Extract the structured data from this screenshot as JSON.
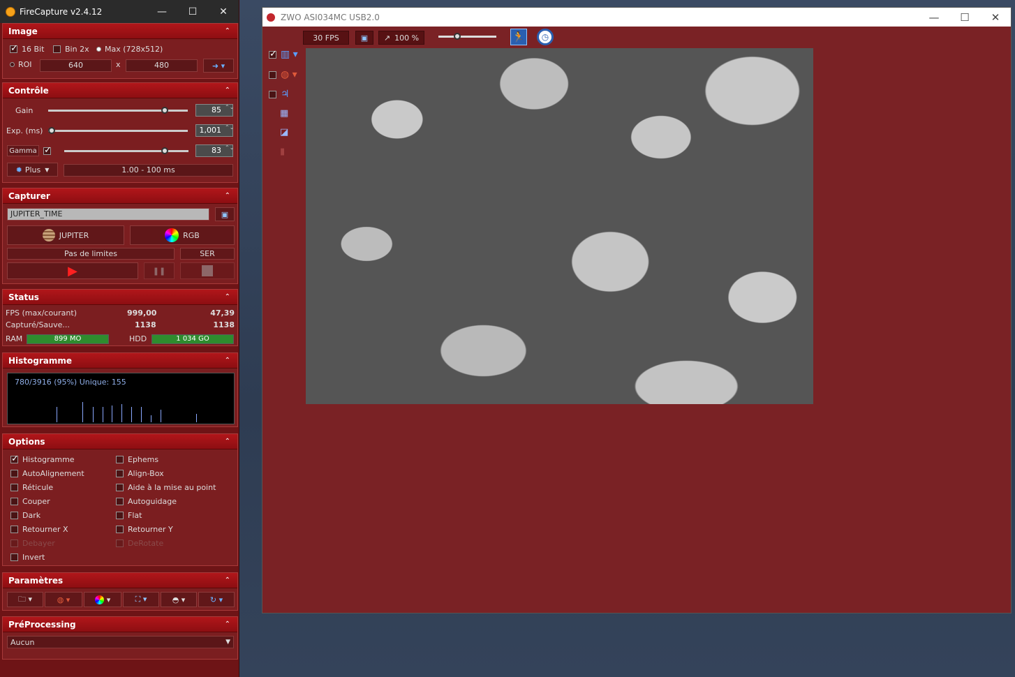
{
  "left_window": {
    "title": "FireCapture v2.4.12",
    "controls": [
      "—",
      "☐",
      "✕"
    ]
  },
  "image": {
    "header": "Image",
    "bit16": "16 Bit",
    "bin2x": "Bin 2x",
    "max": "Max (728x512)",
    "roi": "ROI",
    "roi_w": "640",
    "x": "x",
    "roi_h": "480"
  },
  "control": {
    "header": "Contrôle",
    "gain_label": "Gain",
    "gain_value": "85",
    "gain_level": 0.85,
    "exp_label": "Exp. (ms)",
    "exp_value": "1,001",
    "exp_level": 0.0,
    "gamma_label": "Gamma",
    "gamma_value": "83",
    "gamma_level": 0.83,
    "plus": "Plus",
    "range": "1.00 - 100 ms"
  },
  "capture": {
    "header": "Capturer",
    "name": "JUPITER_TIME",
    "profile": "JUPITER",
    "color": "RGB",
    "limit": "Pas de limites",
    "format": "SER"
  },
  "status": {
    "header": "Status",
    "fps_label": "FPS (max/courant)",
    "fps_max": "999,00",
    "fps_cur": "47,39",
    "cap_label": "Capturé/Sauve...",
    "cap_a": "1138",
    "cap_b": "1138",
    "ram_label": "RAM",
    "ram_value": "899 MO",
    "hdd_label": "HDD",
    "hdd_value": "1 034 GO"
  },
  "histogram": {
    "header": "Histogramme",
    "text": "780/3916 (95%)  Unique: 155"
  },
  "options": {
    "header": "Options",
    "left": [
      {
        "label": "Histogramme",
        "checked": true
      },
      {
        "label": "AutoAlignement"
      },
      {
        "label": "Réticule"
      },
      {
        "label": "Couper"
      },
      {
        "label": "Dark"
      },
      {
        "label": "Retourner X"
      },
      {
        "label": "Debayer",
        "disabled": true
      },
      {
        "label": "Invert"
      }
    ],
    "right": [
      {
        "label": "Ephems"
      },
      {
        "label": "Align-Box"
      },
      {
        "label": "Aide à la mise au point"
      },
      {
        "label": "Autoguidage"
      },
      {
        "label": "Flat"
      },
      {
        "label": "Retourner Y"
      },
      {
        "label": "DeRotate",
        "disabled": true
      }
    ]
  },
  "params": {
    "header": "Paramètres"
  },
  "preprocessing": {
    "header": "PréProcessing",
    "value": "Aucun"
  },
  "right_window": {
    "title": "ZWO ASI034MC USB2.0",
    "controls": [
      "—",
      "☐",
      "✕"
    ],
    "fps": "30 FPS",
    "zoom": "100 %",
    "zoom_level": 0.3
  },
  "colors": {
    "accent": "#b1161a",
    "panel": "#7b1e20",
    "view_bg": "#7a2225"
  }
}
